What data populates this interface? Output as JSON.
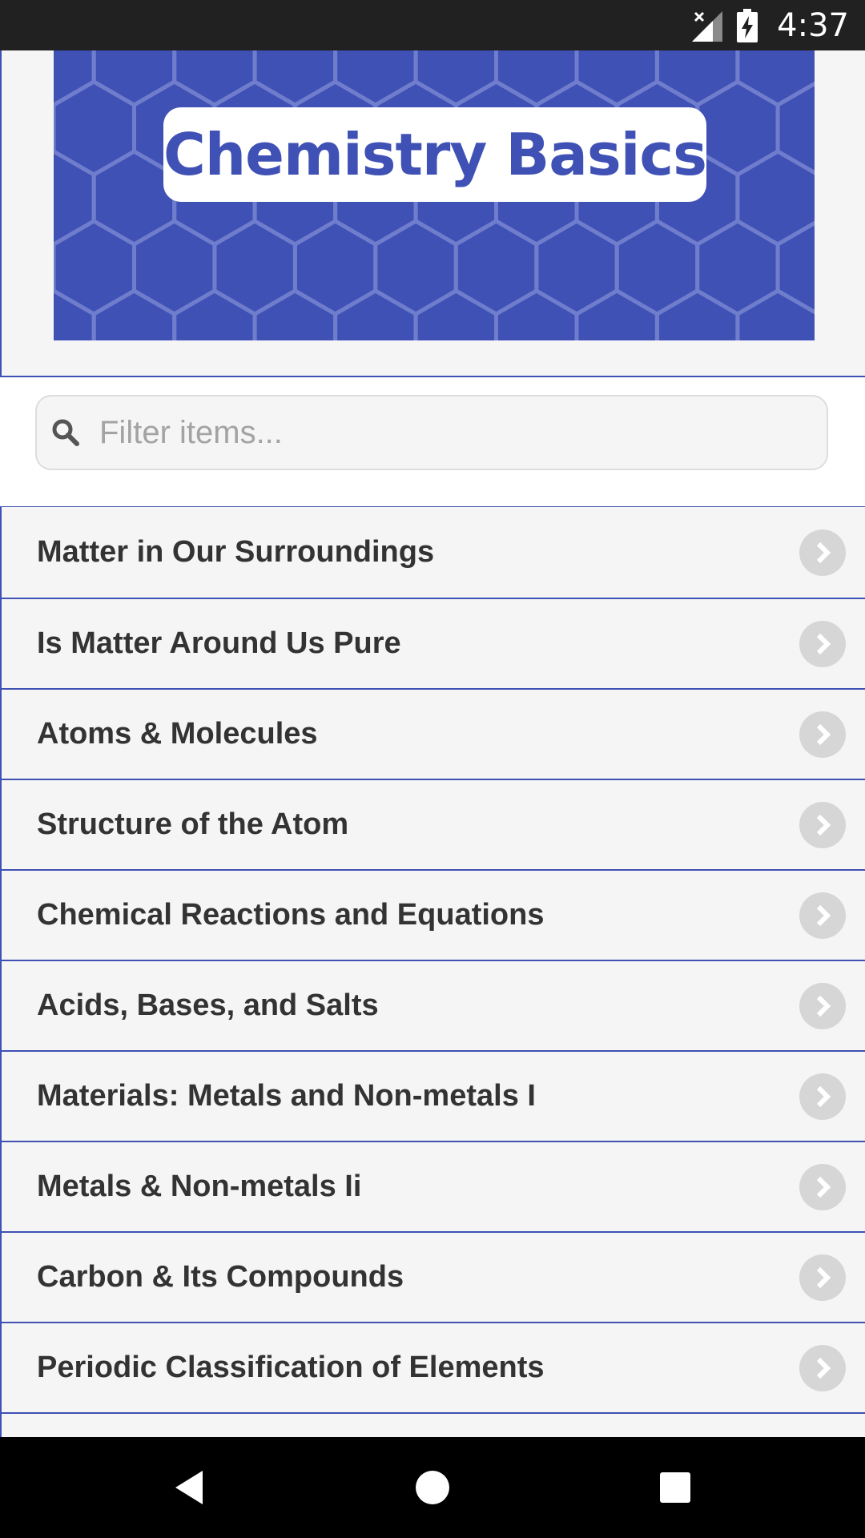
{
  "status_bar": {
    "time": "4:37"
  },
  "header": {
    "banner_title": "Chemistry Basics"
  },
  "search": {
    "placeholder": "Filter items..."
  },
  "list": {
    "items": [
      {
        "label": "Matter in Our Surroundings"
      },
      {
        "label": "Is Matter Around Us Pure"
      },
      {
        "label": "Atoms & Molecules"
      },
      {
        "label": "Structure of the Atom"
      },
      {
        "label": "Chemical Reactions and Equations"
      },
      {
        "label": "Acids, Bases, and Salts"
      },
      {
        "label": "Materials: Metals and Non-metals I"
      },
      {
        "label": "Metals & Non-metals Ii"
      },
      {
        "label": "Carbon & Its Compounds"
      },
      {
        "label": "Periodic Classification of Elements"
      }
    ]
  },
  "icons": {
    "search": "search-icon",
    "chevron": "chevron-right-icon",
    "back": "back-icon",
    "home": "home-icon",
    "recents": "recents-icon",
    "signal": "signal-no-connection-icon",
    "battery": "battery-charging-icon"
  },
  "colors": {
    "accent": "#3f51b5",
    "list_background": "#f5f5f5",
    "text": "#333333",
    "chevron": "#d6d6d6"
  }
}
